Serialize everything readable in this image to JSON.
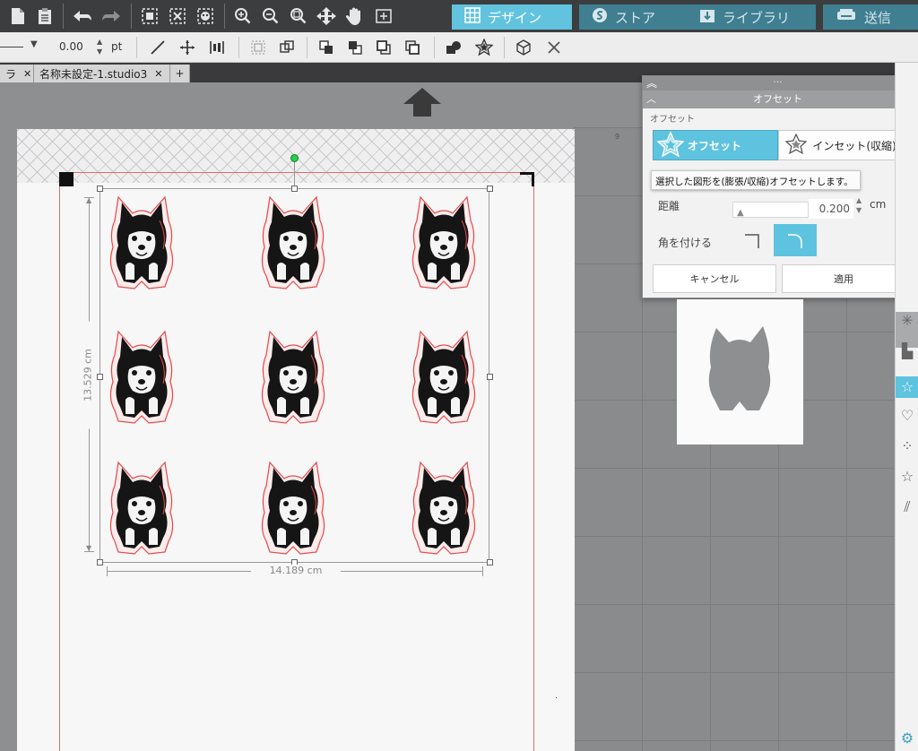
{
  "toolbar": {
    "modes": [
      {
        "label": "デザイン",
        "icon": "grid-icon",
        "active": true
      },
      {
        "label": "ストア",
        "icon": "store-icon",
        "active": false
      },
      {
        "label": "ライブラリ",
        "icon": "library-icon",
        "active": false
      },
      {
        "label": "送信",
        "icon": "send-icon",
        "active": false
      }
    ]
  },
  "line_style": {
    "width_value": "0.00",
    "unit": "pt"
  },
  "tabs": [
    {
      "label": "ラ"
    },
    {
      "label": "名称未設定-1.studio3"
    }
  ],
  "tab_add_label": "+",
  "canvas": {
    "height_dimension": "13.529 cm",
    "width_dimension": "14.189 cm",
    "sticker_grid": {
      "rows": 3,
      "cols": 3
    }
  },
  "offset_panel": {
    "title": "オフセット",
    "header_dots": "···",
    "section_label": "オフセット",
    "offset_button": "オフセット",
    "inset_button": "インセット(収縮)",
    "tooltip": "選択した図形を(膨張/収縮)オフセットします。",
    "distance_label": "距離",
    "distance_value": "0.200",
    "distance_unit": "cm",
    "corner_label": "角を付ける",
    "corner_options": [
      "sharp",
      "rounded"
    ],
    "corner_selected": "rounded",
    "cancel_button": "キャンセル",
    "apply_button": "適用"
  },
  "mat_ruler_label": "9",
  "colors": {
    "accent": "#5ec3df",
    "toolbar_dark": "#3c3d3f",
    "cut_line": "#e36b6b"
  }
}
